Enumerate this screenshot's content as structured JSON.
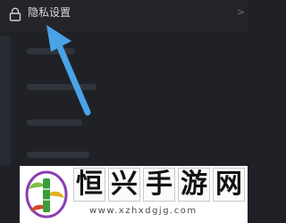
{
  "settings": {
    "privacy_row": {
      "label": "隐私设置",
      "chevron": ">",
      "icon": "lock-icon"
    }
  },
  "annotation": {
    "icon": "pointer-arrow-icon",
    "color": "#4aa3e6"
  },
  "watermark": {
    "title_chars": [
      "恒",
      "兴",
      "手",
      "游",
      "网"
    ],
    "url": "www.xzhxdgjg.com"
  }
}
